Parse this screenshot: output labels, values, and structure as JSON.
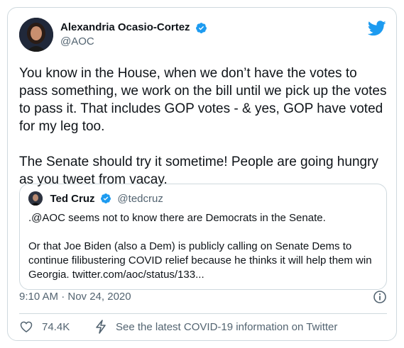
{
  "author": {
    "name": "Alexandria Ocasio-Cortez",
    "handle": "@AOC"
  },
  "tweet": {
    "paragraph_1": "You know in the House, when we don’t have the votes to pass something, we work on the bill until we pick up the votes to pass it. That includes GOP votes - & yes, GOP have voted for my leg too.",
    "paragraph_2": "The Senate should try it sometime! People are going hungry as you tweet from vacay."
  },
  "quoted": {
    "name": "Ted Cruz",
    "handle": "@tedcruz",
    "paragraph_1": ".@AOC seems not to know there are Democrats in the Senate.",
    "paragraph_2": "Or that Joe Biden (also a Dem) is publicly calling on Senate Dems to continue filibustering COVID relief because he thinks it will help them win Georgia. twitter.com/aoc/status/133..."
  },
  "meta": {
    "timestamp": "9:10 AM · Nov 24, 2020"
  },
  "actions": {
    "like_count": "74.4K",
    "covid_info": "See the latest COVID-19 information on Twitter"
  },
  "colors": {
    "twitter_blue": "#1d9bf0",
    "text_secondary": "#536471",
    "border": "#cfd9de"
  },
  "icons": [
    "verified-badge-icon",
    "twitter-bird-icon",
    "info-icon",
    "heart-icon",
    "lightning-icon"
  ]
}
